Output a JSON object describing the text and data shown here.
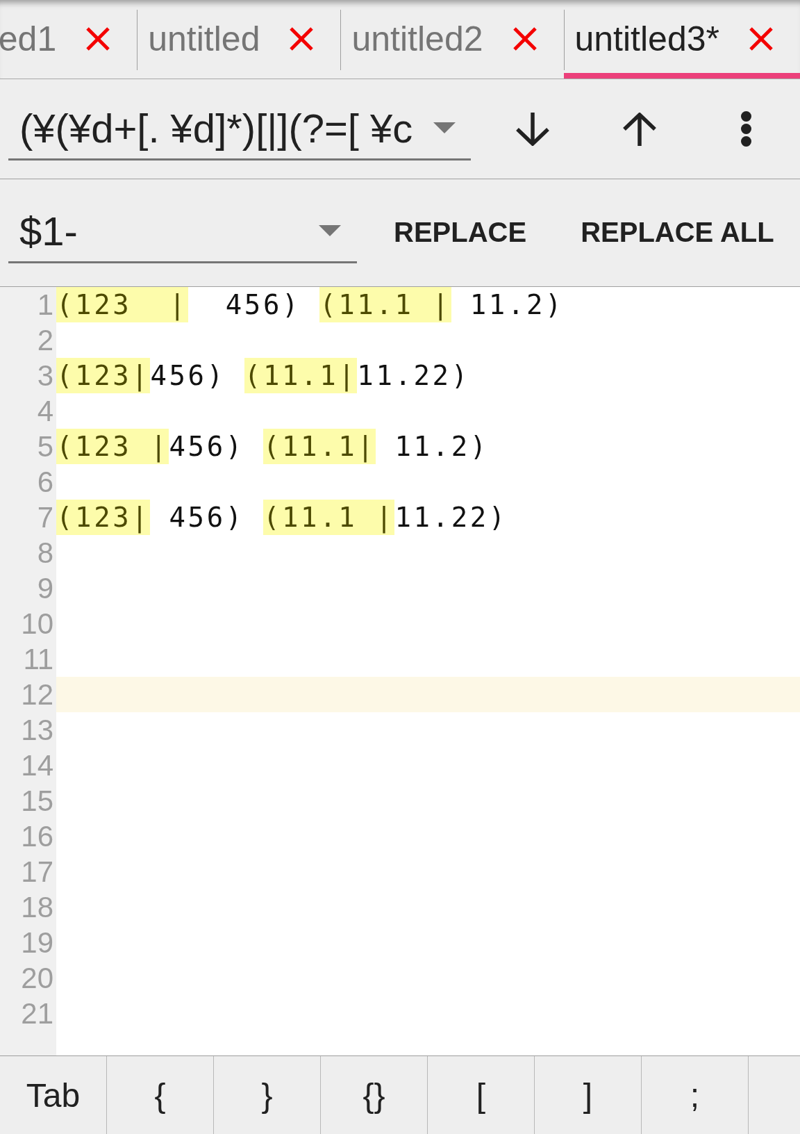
{
  "tabs": [
    {
      "label": "ed1",
      "selected": false
    },
    {
      "label": "untitled",
      "selected": false
    },
    {
      "label": "untitled2",
      "selected": false
    },
    {
      "label": "untitled3*",
      "selected": true
    }
  ],
  "find_bar": {
    "search": {
      "value": "(¥(¥d+[. ¥d]*)[|](?=[ ¥c"
    }
  },
  "replace_bar": {
    "replace": {
      "value": "$1-"
    },
    "buttons": [
      "REPLACE",
      "REPLACE ALL"
    ]
  },
  "editor": {
    "lines": [
      {
        "number": "1",
        "current": false,
        "segments": [
          {
            "text": "(123  |",
            "match": true
          },
          {
            "text": "  456) ",
            "match": false
          },
          {
            "text": "(11.1 |",
            "match": true
          },
          {
            "text": " 11.2)",
            "match": false
          }
        ]
      },
      {
        "number": "2",
        "current": false
      },
      {
        "number": "3",
        "current": false,
        "segments": [
          {
            "text": "(123|",
            "match": true
          },
          {
            "text": "456) ",
            "match": false
          },
          {
            "text": "(11.1|",
            "match": true
          },
          {
            "text": "11.22)",
            "match": false
          }
        ]
      },
      {
        "number": "4",
        "current": false
      },
      {
        "number": "5",
        "current": false,
        "segments": [
          {
            "text": "(123 |",
            "match": true
          },
          {
            "text": "456) ",
            "match": false
          },
          {
            "text": "(11.1|",
            "match": true
          },
          {
            "text": " 11.2)",
            "match": false
          }
        ]
      },
      {
        "number": "6",
        "current": false
      },
      {
        "number": "7",
        "current": false,
        "segments": [
          {
            "text": "(123|",
            "match": true
          },
          {
            "text": " 456) ",
            "match": false
          },
          {
            "text": "(11.1 |",
            "match": true
          },
          {
            "text": "11.22)",
            "match": false
          }
        ]
      },
      {
        "number": "8",
        "current": false
      },
      {
        "number": "9",
        "current": false
      },
      {
        "number": "10",
        "current": false
      },
      {
        "number": "11",
        "current": false
      },
      {
        "number": "12",
        "current": true
      },
      {
        "number": "13",
        "current": false
      },
      {
        "number": "14",
        "current": false
      },
      {
        "number": "15",
        "current": false
      },
      {
        "number": "16",
        "current": false
      },
      {
        "number": "17",
        "current": false
      },
      {
        "number": "18",
        "current": false
      },
      {
        "number": "19",
        "current": false
      },
      {
        "number": "20",
        "current": false
      },
      {
        "number": "21",
        "current": false
      }
    ]
  },
  "keys": [
    "Tab",
    "{",
    "}",
    "{}",
    "[",
    "]",
    ";"
  ]
}
